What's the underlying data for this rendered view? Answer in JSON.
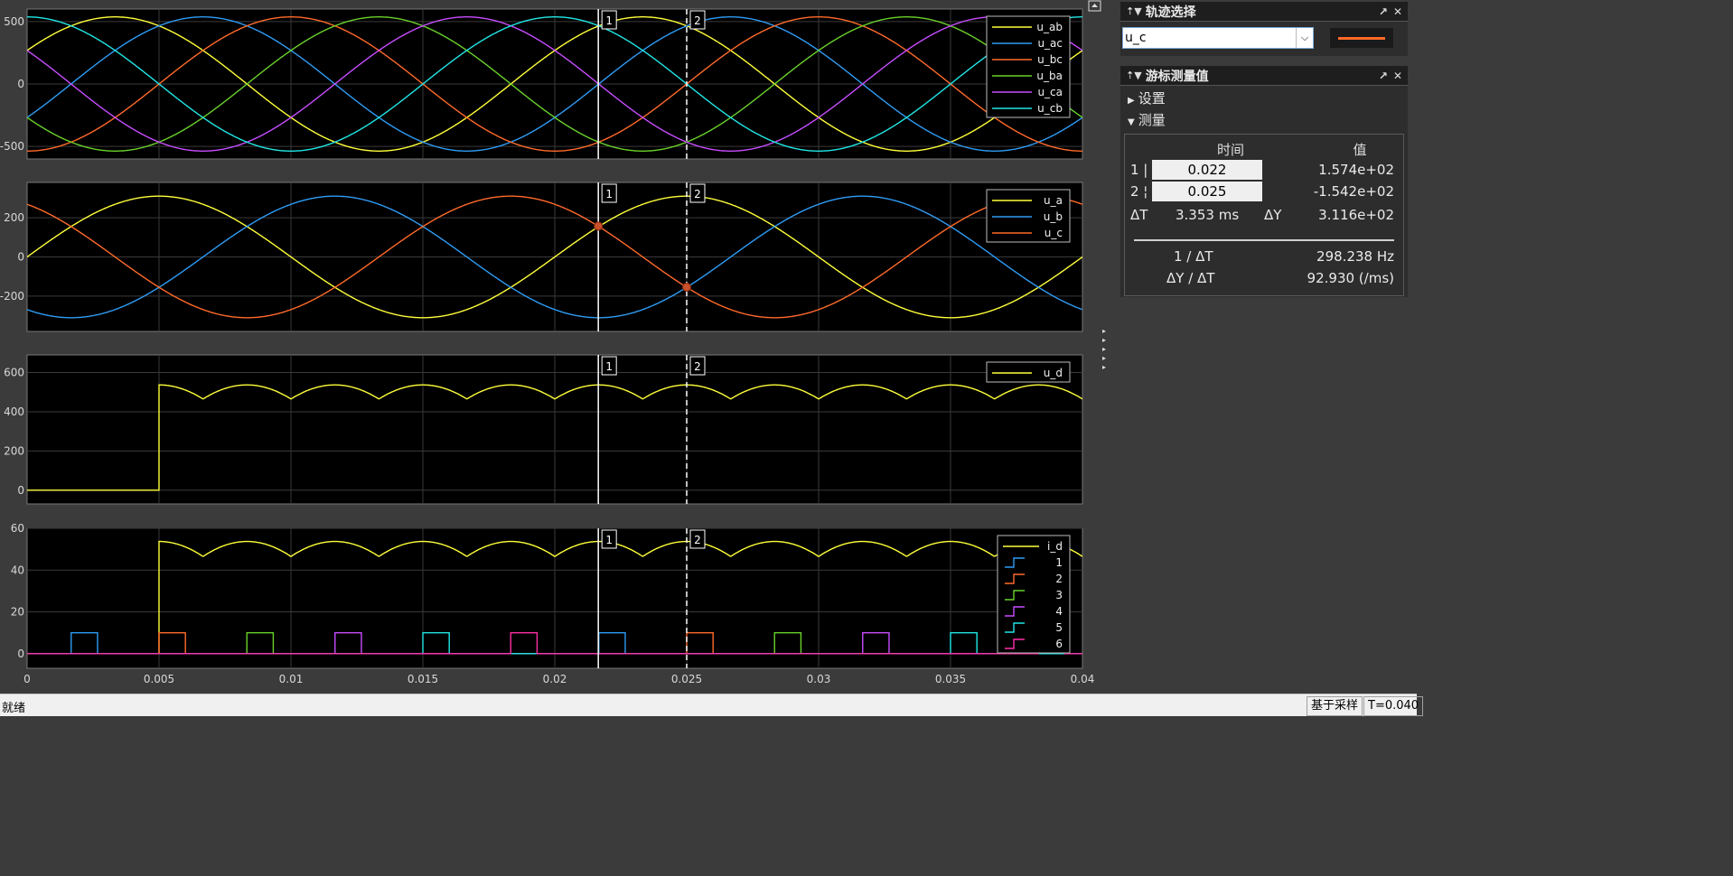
{
  "scope": {
    "x_axis": {
      "ticks": [
        0,
        0.005,
        0.01,
        0.015,
        0.02,
        0.025,
        0.03,
        0.035,
        0.04
      ],
      "tick_labels": [
        "0",
        "0.005",
        "0.01",
        "0.015",
        "0.02",
        "0.025",
        "0.03",
        "0.035",
        "0.04"
      ]
    },
    "cursor1": {
      "t": 0.02165,
      "label": "1"
    },
    "cursor2": {
      "t": 0.025,
      "label": "2"
    },
    "export_icon": "dock-arrow-icon"
  },
  "chart_data": [
    {
      "type": "line",
      "ylim": [
        -600,
        600
      ],
      "yticks": [
        500,
        0,
        -500
      ],
      "ytick_labels": [
        "500",
        "0",
        "-500"
      ],
      "xlim": [
        0,
        0.04
      ],
      "legend_position": "top-right",
      "series": [
        {
          "name": "u_ab",
          "color": "#ffff3a",
          "amplitude": 537,
          "freq": 50,
          "phase_deg": 30
        },
        {
          "name": "u_ac",
          "color": "#2e9cf5",
          "amplitude": 537,
          "freq": 50,
          "phase_deg": -30
        },
        {
          "name": "u_bc",
          "color": "#ff6a2a",
          "amplitude": 537,
          "freq": 50,
          "phase_deg": -90
        },
        {
          "name": "u_ba",
          "color": "#6ad12a",
          "amplitude": 537,
          "freq": 50,
          "phase_deg": 210
        },
        {
          "name": "u_ca",
          "color": "#c74dff",
          "amplitude": 537,
          "freq": 50,
          "phase_deg": 150
        },
        {
          "name": "u_cb",
          "color": "#21e6e6",
          "amplitude": 537,
          "freq": 50,
          "phase_deg": 90
        }
      ]
    },
    {
      "type": "line",
      "ylim": [
        -380,
        380
      ],
      "yticks": [
        200,
        0,
        -200
      ],
      "ytick_labels": [
        "200",
        "0",
        "-200"
      ],
      "xlim": [
        0,
        0.04
      ],
      "legend_position": "top-right",
      "cursor_markers": [
        {
          "t": 0.02165,
          "y": 157.4
        },
        {
          "t": 0.025,
          "y": -154.2
        }
      ],
      "series": [
        {
          "name": "u_a",
          "color": "#ffff3a",
          "amplitude": 310,
          "freq": 50,
          "phase_deg": 0
        },
        {
          "name": "u_b",
          "color": "#2e9cf5",
          "amplitude": 310,
          "freq": 50,
          "phase_deg": -120
        },
        {
          "name": "u_c",
          "color": "#ff6a2a",
          "amplitude": 310,
          "freq": 50,
          "phase_deg": 120
        }
      ]
    },
    {
      "type": "line",
      "ylim": [
        -70,
        690
      ],
      "yticks": [
        600,
        400,
        200,
        0
      ],
      "ytick_labels": [
        "600",
        "400",
        "200",
        "0"
      ],
      "xlim": [
        0,
        0.04
      ],
      "legend_position": "top-right",
      "series": [
        {
          "name": "u_d",
          "color": "#ffff3a",
          "kind": "rectified",
          "peak": 537,
          "start": 0.005,
          "pre_value": 0
        }
      ]
    },
    {
      "type": "line",
      "ylim": [
        -7,
        60
      ],
      "yticks": [
        60,
        40,
        20,
        0
      ],
      "ytick_labels": [
        "60",
        "40",
        "20",
        "0"
      ],
      "xlim": [
        0,
        0.04
      ],
      "legend_position": "top-right",
      "series": [
        {
          "name": "i_d",
          "color": "#ffff3a",
          "kind": "rectified",
          "peak": 53.7,
          "start": 0.005,
          "pre_value": 0
        },
        {
          "name": "1",
          "color": "#2e9cf5",
          "kind": "pulses",
          "height": 10,
          "width": 0.001,
          "starts": [
            0.00167,
            0.02167
          ]
        },
        {
          "name": "2",
          "color": "#ff6a2a",
          "kind": "pulses",
          "height": 10,
          "width": 0.001,
          "starts": [
            0.005,
            0.025
          ]
        },
        {
          "name": "3",
          "color": "#6ad12a",
          "kind": "pulses",
          "height": 10,
          "width": 0.001,
          "starts": [
            0.00833,
            0.02833
          ]
        },
        {
          "name": "4",
          "color": "#c74dff",
          "kind": "pulses",
          "height": 10,
          "width": 0.001,
          "starts": [
            0.01167,
            0.03167
          ]
        },
        {
          "name": "5",
          "color": "#21e6e6",
          "kind": "pulses",
          "height": 10,
          "width": 0.001,
          "starts": [
            0.015,
            0.035
          ]
        },
        {
          "name": "6",
          "color": "#ff2fa8",
          "kind": "pulses",
          "height": 10,
          "width": 0.001,
          "starts": [
            0.01833,
            0.03833
          ]
        }
      ]
    }
  ],
  "trace_panel": {
    "title": "轨迹选择",
    "selected": "u_c",
    "swatch_color": "#ff6a2a"
  },
  "measure_panel": {
    "title": "游标测量值",
    "settings_label": "设置",
    "measure_label": "测量",
    "header_time": "时间",
    "header_value": "值",
    "rows": [
      {
        "label": "1 |",
        "time": "0.022",
        "value": "1.574e+02"
      },
      {
        "label": "2 ¦",
        "time": "0.025",
        "value": "-1.542e+02"
      }
    ],
    "dt_label": "ΔT",
    "dt_value": "3.353 ms",
    "dy_label": "ΔY",
    "dy_value": "3.116e+02",
    "inv_dt_label": "1 / ΔT",
    "inv_dt_value": "298.238 Hz",
    "dydt_label": "ΔY / ΔT",
    "dydt_value": "92.930 (/ms)"
  },
  "status": {
    "ready": "就绪",
    "mode": "基于采样",
    "time": "T=0.040"
  }
}
